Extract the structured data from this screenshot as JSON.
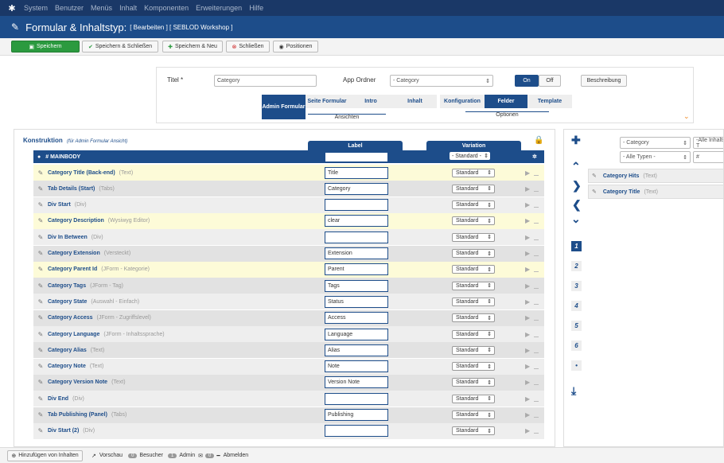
{
  "topnav": {
    "items": [
      "System",
      "Benutzer",
      "Menüs",
      "Inhalt",
      "Komponenten",
      "Erweiterungen",
      "Hilfe"
    ]
  },
  "header": {
    "title": "Formular & Inhaltstyp:",
    "subtitle": "[ Bearbeiten ] [ SEBLOD Workshop ]"
  },
  "toolbar": {
    "save": "Speichern",
    "save_close": "Speichern & Schließen",
    "save_new": "Speichern & Neu",
    "close": "Schließen",
    "positions": "Positionen"
  },
  "form": {
    "title_label": "Titel *",
    "title_value": "Category",
    "app_folder_label": "App Ordner",
    "app_folder_value": "- Category",
    "on_label": "On",
    "off_label": "Off",
    "description_label": "Beschreibung",
    "views_tabs": [
      "Admin Formular",
      "Seite Formular",
      "Intro",
      "Inhalt"
    ],
    "views_group": "Ansichten",
    "options_tabs": [
      "Konfiguration",
      "Felder",
      "Template"
    ],
    "options_group": "Optionen"
  },
  "construction": {
    "title": "Konstruktion",
    "subtitle": "(für Admin Formular Ansicht)",
    "label_header": "Label",
    "variation_header": "Variation",
    "mainbody": "# MAINBODY",
    "mainbody_variation": "- Standard -",
    "rows": [
      {
        "name": "Category Title (Back-end)",
        "type": "(Text)",
        "label": "Title",
        "variation": "Standard"
      },
      {
        "name": "Tab Details (Start)",
        "type": "(Tabs)",
        "label": "Category",
        "variation": "Standard"
      },
      {
        "name": "Div Start",
        "type": "(Div)",
        "label": "",
        "variation": "Standard"
      },
      {
        "name": "Category Description",
        "type": "(Wysiwyg Editor)",
        "label": "clear",
        "variation": "Standard"
      },
      {
        "name": "Div In Between",
        "type": "(Div)",
        "label": "",
        "variation": "Standard"
      },
      {
        "name": "Category Extension",
        "type": "(Versteckt)",
        "label": "Extension",
        "variation": "Standard"
      },
      {
        "name": "Category Parent Id",
        "type": "(JForm - Kategorie)",
        "label": "Parent",
        "variation": "Standard"
      },
      {
        "name": "Category Tags",
        "type": "(JForm - Tag)",
        "label": "Tags",
        "variation": "Standard"
      },
      {
        "name": "Category State",
        "type": "(Auswahl - Einfach)",
        "label": "Status",
        "variation": "Standard"
      },
      {
        "name": "Category Access",
        "type": "(JForm - Zugriffslevel)",
        "label": "Access",
        "variation": "Standard"
      },
      {
        "name": "Category Language",
        "type": "(JForm - Inhaltssprache)",
        "label": "Language",
        "variation": "Standard"
      },
      {
        "name": "Category Alias",
        "type": "(Text)",
        "label": "Alias",
        "variation": "Standard"
      },
      {
        "name": "Category Note",
        "type": "(Text)",
        "label": "Note",
        "variation": "Standard"
      },
      {
        "name": "Category Version Note",
        "type": "(Text)",
        "label": "Version Note",
        "variation": "Standard"
      },
      {
        "name": "Div End",
        "type": "(Div)",
        "label": "",
        "variation": "Standard"
      },
      {
        "name": "Tab Publishing (Panel)",
        "type": "(Tabs)",
        "label": "Publishing",
        "variation": "Standard"
      },
      {
        "name": "Div Start (2)",
        "type": "(Div)",
        "label": "",
        "variation": "Standard"
      }
    ]
  },
  "sidebar": {
    "filter_category": "- Category",
    "filter_all_content": "-Alle Inhalts-T",
    "filter_types": "- Alle Typen -",
    "filter_hash": "#",
    "pages": [
      "1",
      "2",
      "3",
      "4",
      "5",
      "6",
      "•"
    ],
    "items": [
      {
        "name": "Category Hits",
        "type": "(Text)"
      },
      {
        "name": "Category Title",
        "type": "(Text)"
      }
    ]
  },
  "footer": {
    "add_content": "Hinzufügen von Inhalten",
    "preview": "Vorschau",
    "visitors_count": "0",
    "visitors": "Besucher",
    "admin_count": "1",
    "admin": "Admin",
    "msg_count": "0",
    "logout": "Abmelden"
  }
}
